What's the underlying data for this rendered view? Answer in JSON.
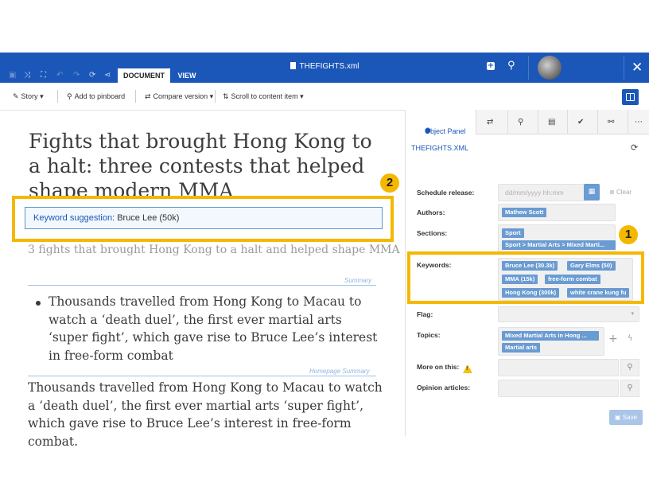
{
  "app": {
    "doc_title": "THEFIGHTS.xml",
    "tabs": [
      "DOCUMENT",
      "VIEW"
    ]
  },
  "toolbar": {
    "story": "Story",
    "pinboard": "Add to pinboard",
    "compare": "Compare version",
    "scroll": "Scroll to content item"
  },
  "document": {
    "headline": "Fights that brought Hong Kong to a halt: three contests that helped shape modern MMA",
    "keyword_suggestion_label": "Keyword suggestion:",
    "keyword_suggestion_value": "Bruce Lee (50k)",
    "summary": "3 fights that brought Hong Kong to a halt and helped shape MMA",
    "summary_label": "Summary",
    "bullet": "Thousands travelled from Hong Kong to Macau to watch a ‘death duel’, the first ever martial arts ‘super fight’, which gave rise to Bruce Lee’s interest in free-form combat",
    "homepage_summary_label": "Homepage Summary",
    "body": "Thousands travelled from Hong Kong to Macau to watch a ‘death duel’, the first ever martial arts ‘super fight’, which gave rise to Bruce Lee’s interest in free-form combat."
  },
  "panel": {
    "active_tab": "Object Panel",
    "file_label": "THEFIGHTS.XML",
    "schedule_label": "Schedule release:",
    "schedule_placeholder": "dd/mm/yyyy hh:mm",
    "clear_label": "Clear",
    "authors_label": "Authors:",
    "authors": [
      "Mathew Scott"
    ],
    "sections_label": "Sections:",
    "sections": [
      "Sport",
      "Sport > Martial Arts > Mixed Marti..."
    ],
    "keywords_label": "Keywords:",
    "keywords": [
      "Bruce Lee (30.3k)",
      "Gary Elms (50)",
      "MMA (15k)",
      "free-form combat",
      "Hong Kong (300k)",
      "white crane kung fu"
    ],
    "flag_label": "Flag:",
    "topics_label": "Topics:",
    "topics": [
      "Mixed Martial Arts in Hong ...",
      "Martial arts"
    ],
    "more_label": "More on this:",
    "opinion_label": "Opinion articles:",
    "save_label": "Save"
  },
  "callouts": {
    "one": "1",
    "two": "2",
    "color": "#f5b800"
  },
  "colors": {
    "topbar": "#1b57b8",
    "chip": "#6a9bd2"
  }
}
